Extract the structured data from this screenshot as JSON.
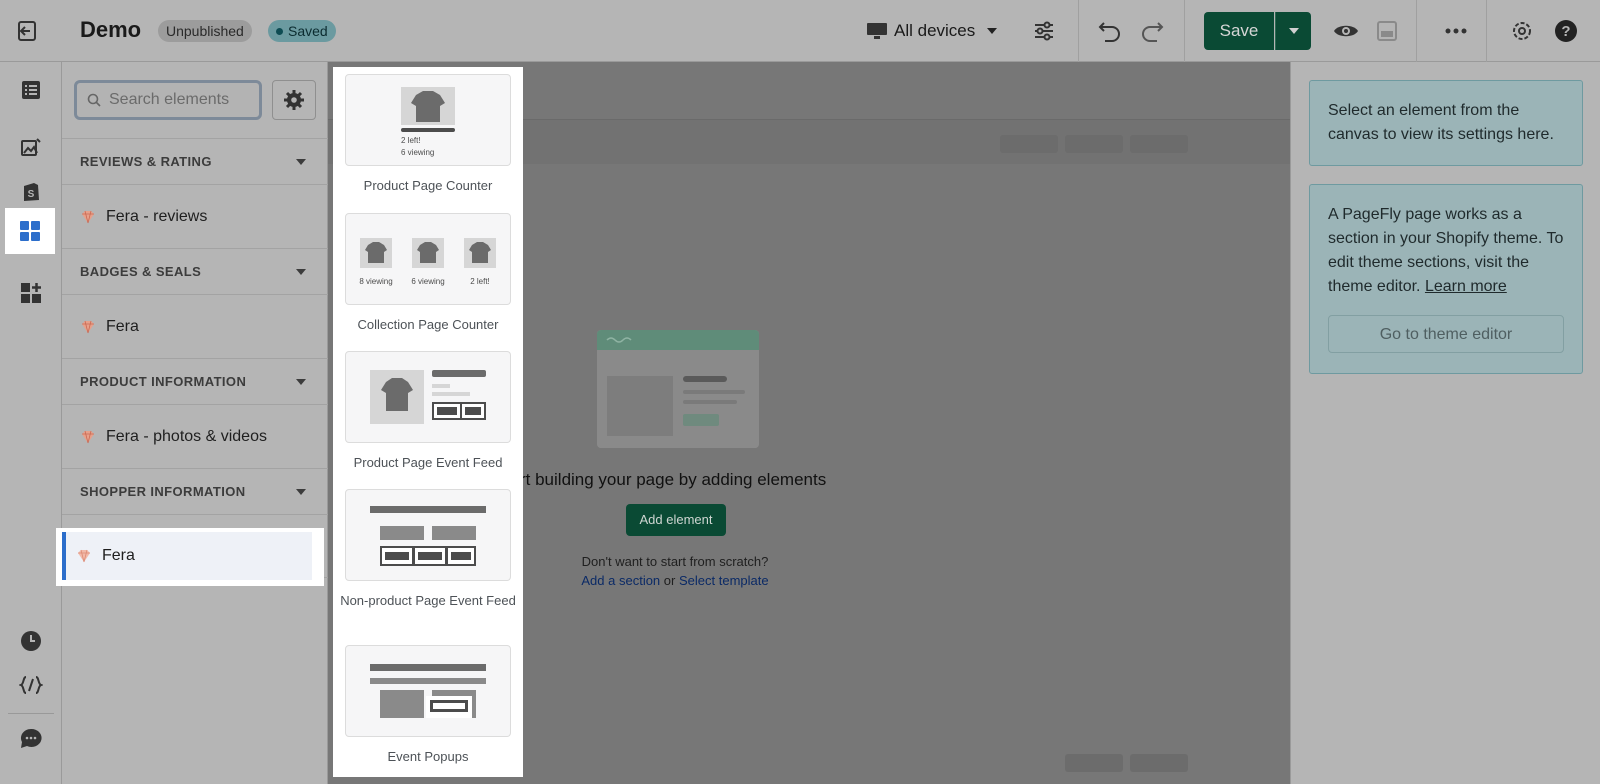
{
  "header": {
    "title": "Demo",
    "status_unpublished": "Unpublished",
    "status_saved": "Saved",
    "devices_label": "All devices",
    "save_label": "Save"
  },
  "panel": {
    "search_placeholder": "Search elements",
    "categories": [
      {
        "title": "REVIEWS & RATING",
        "item": "Fera - reviews"
      },
      {
        "title": "BADGES & SEALS",
        "item": "Fera"
      },
      {
        "title": "PRODUCT INFORMATION",
        "item": "Fera - photos & videos"
      },
      {
        "title": "SHOPPER INFORMATION",
        "item": "Fera"
      }
    ]
  },
  "popover": {
    "cards": [
      {
        "label": "Product Page Counter",
        "text1": "2 left!",
        "text2": "6 viewing"
      },
      {
        "label": "Collection Page Counter",
        "t1": "8 viewing",
        "t2": "6 viewing",
        "t3": "2 left!"
      },
      {
        "label": "Product Page Event Feed"
      },
      {
        "label": "Non-product Page Event Feed"
      },
      {
        "label": "Event Popups"
      }
    ]
  },
  "canvas": {
    "empty_title": "rt building your page by adding elements",
    "add_element": "Add element",
    "scratch_text": "Don't want to start from scratch?",
    "add_section": "Add a section",
    "or": "or",
    "select_template": "Select template"
  },
  "settings": {
    "select_hint": "Select an element from the canvas to view its settings here.",
    "section_info": "A PageFly page works as a section in your Shopify theme. To edit theme sections, visit the theme editor.",
    "learn_more": "Learn more",
    "theme_button": "Go to theme editor"
  }
}
